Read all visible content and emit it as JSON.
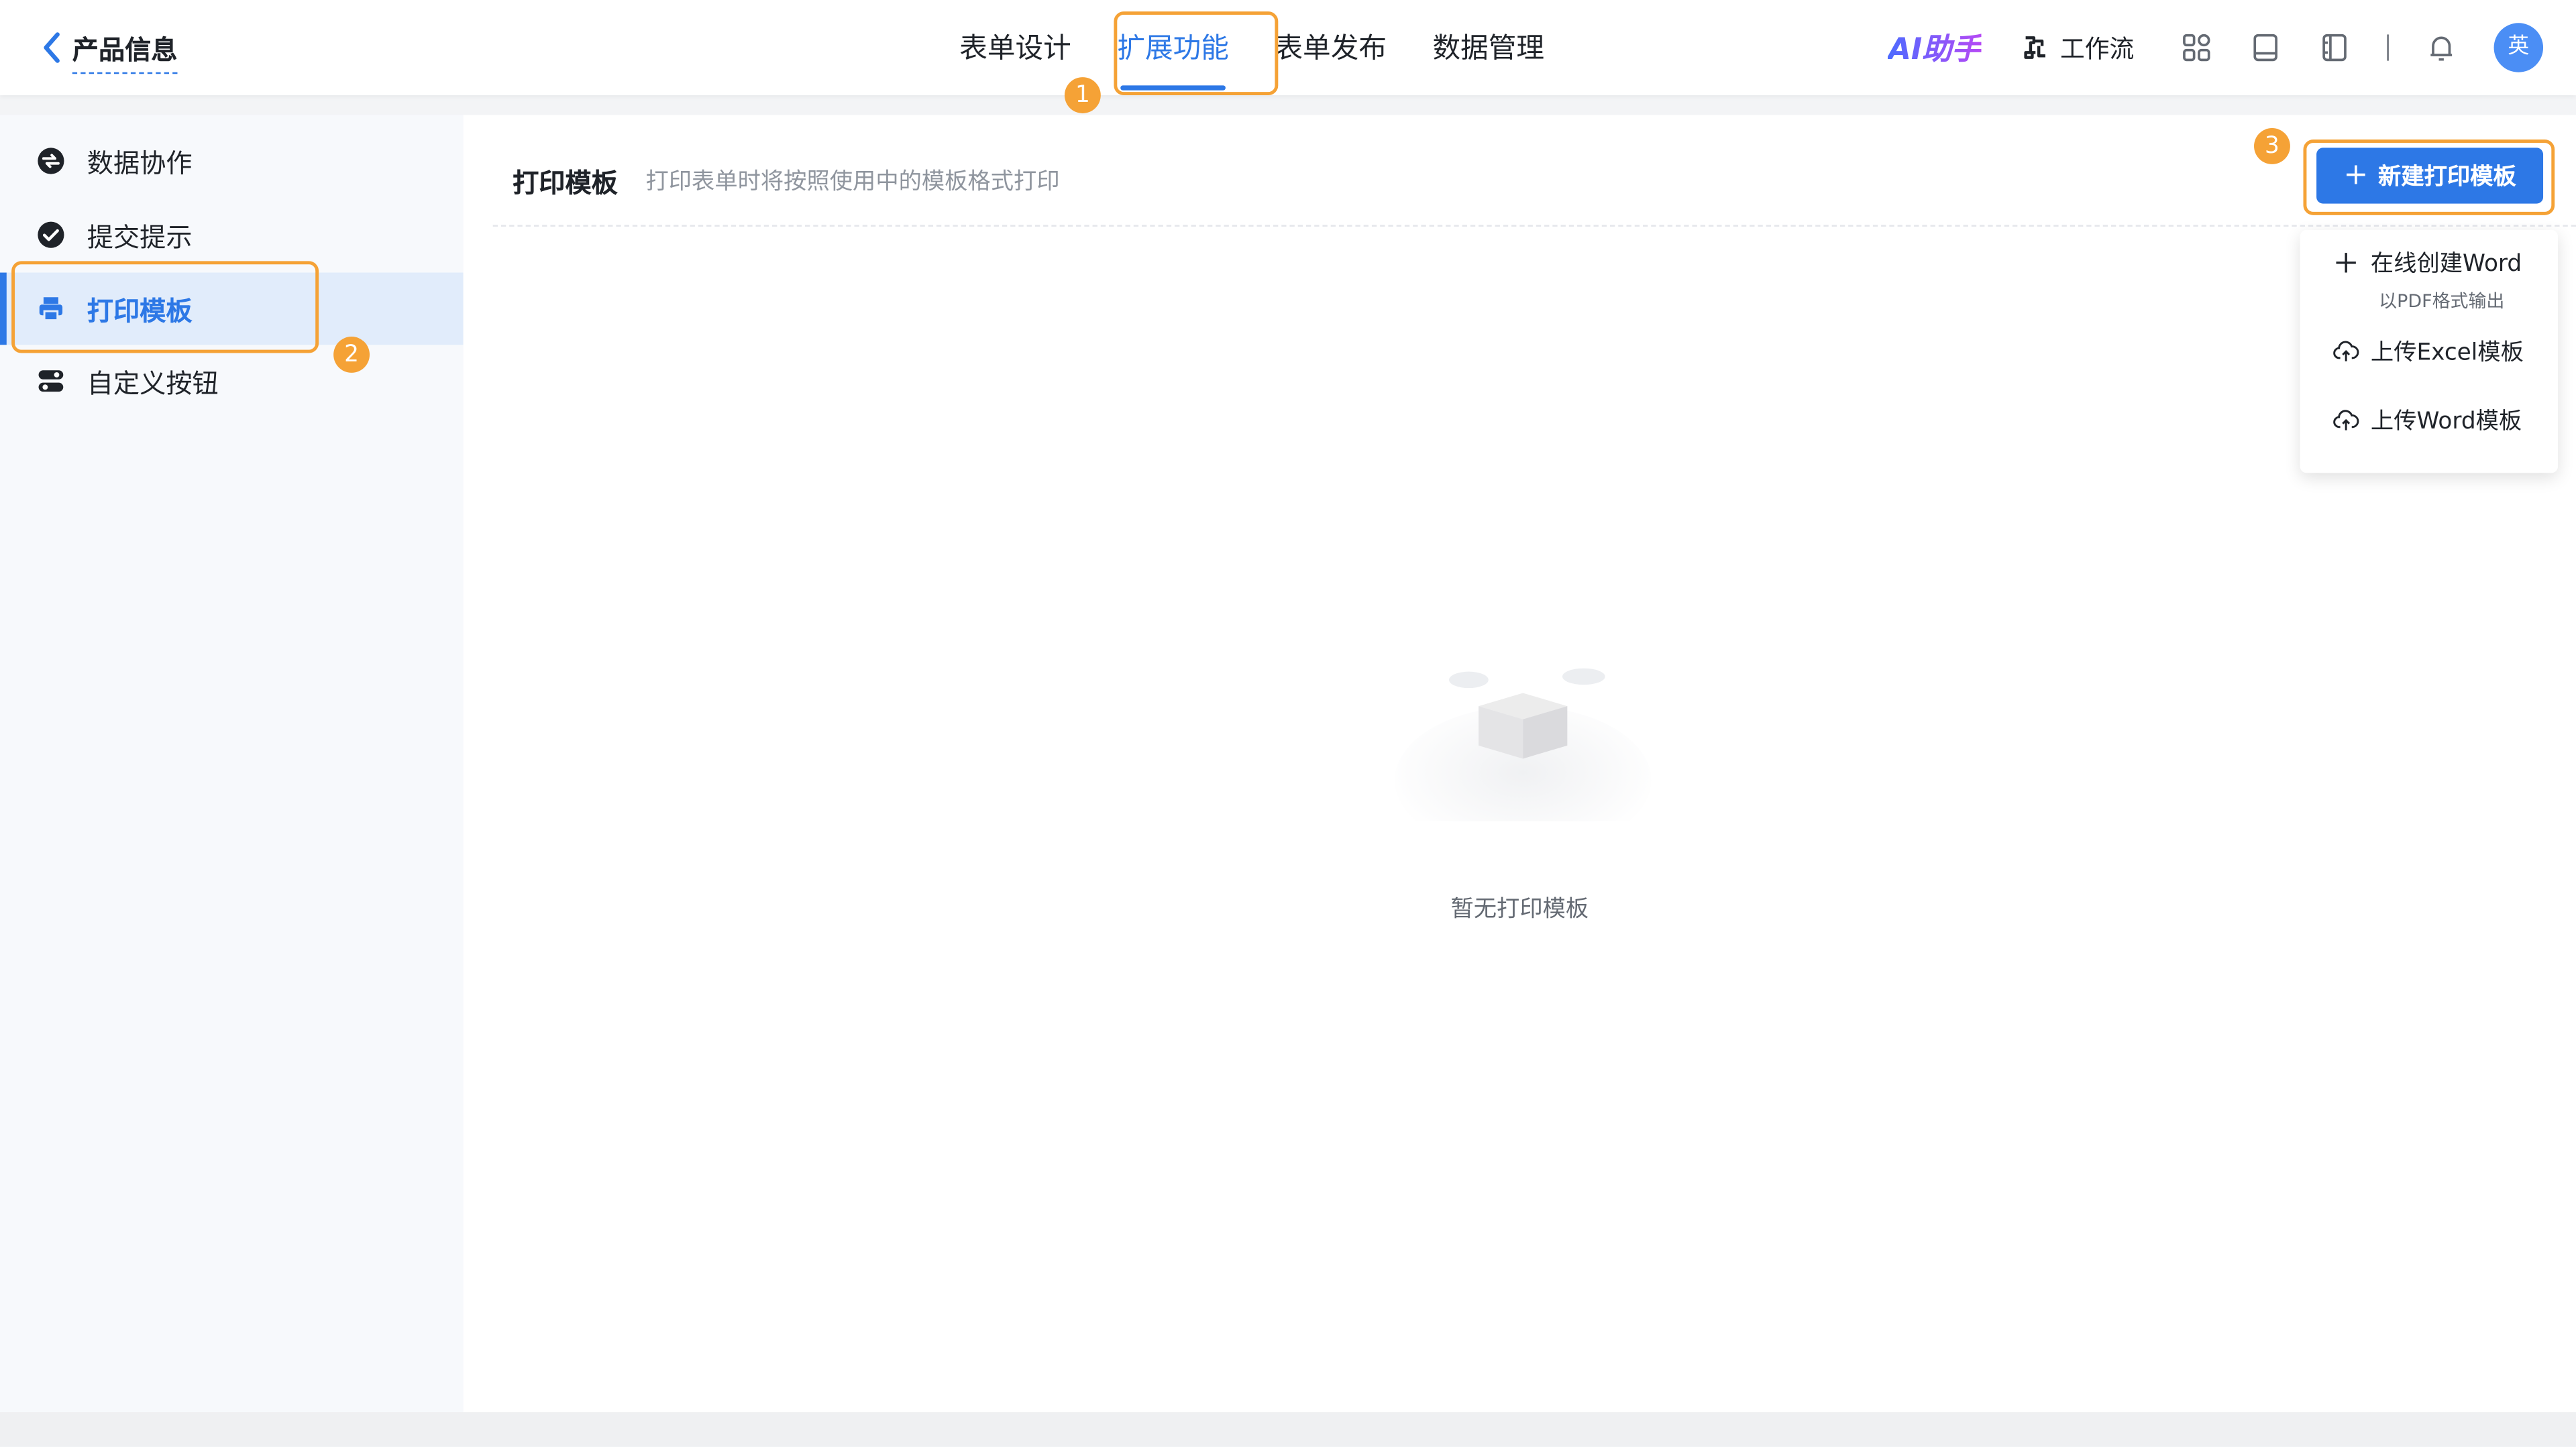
{
  "header": {
    "back_label": "产品信息",
    "tabs": [
      {
        "label": "表单设计"
      },
      {
        "label": "扩展功能",
        "active": true
      },
      {
        "label": "表单发布"
      },
      {
        "label": "数据管理"
      }
    ],
    "ai_label": "AI助手",
    "workflow_label": "工作流",
    "avatar_text": "英",
    "icons": [
      "apps-icon",
      "book-icon",
      "notebook-icon",
      "bell-icon"
    ]
  },
  "annotations": {
    "badge1": "1",
    "badge2": "2",
    "badge3": "3"
  },
  "sidebar": {
    "items": [
      {
        "label": "数据协作",
        "icon": "collaboration-icon"
      },
      {
        "label": "提交提示",
        "icon": "check-circle-icon"
      },
      {
        "label": "打印模板",
        "icon": "printer-icon",
        "active": true
      },
      {
        "label": "自定义按钮",
        "icon": "toggle-icon"
      }
    ]
  },
  "main": {
    "title": "打印模板",
    "description": "打印表单时将按照使用中的模板格式打印",
    "new_button_label": "新建打印模板",
    "dropdown": {
      "items": [
        {
          "label": "在线创建Word",
          "sub": "以PDF格式输出",
          "icon": "plus-icon"
        },
        {
          "label": "上传Excel模板",
          "icon": "cloud-upload-icon"
        },
        {
          "label": "上传Word模板",
          "icon": "cloud-upload-icon"
        }
      ]
    },
    "empty_text": "暂无打印模板"
  },
  "colors": {
    "primary": "#2d78e6",
    "highlight": "#f5a236",
    "sidebar_bg": "#f7f9fc",
    "active_bg": "#e1ecfb"
  }
}
